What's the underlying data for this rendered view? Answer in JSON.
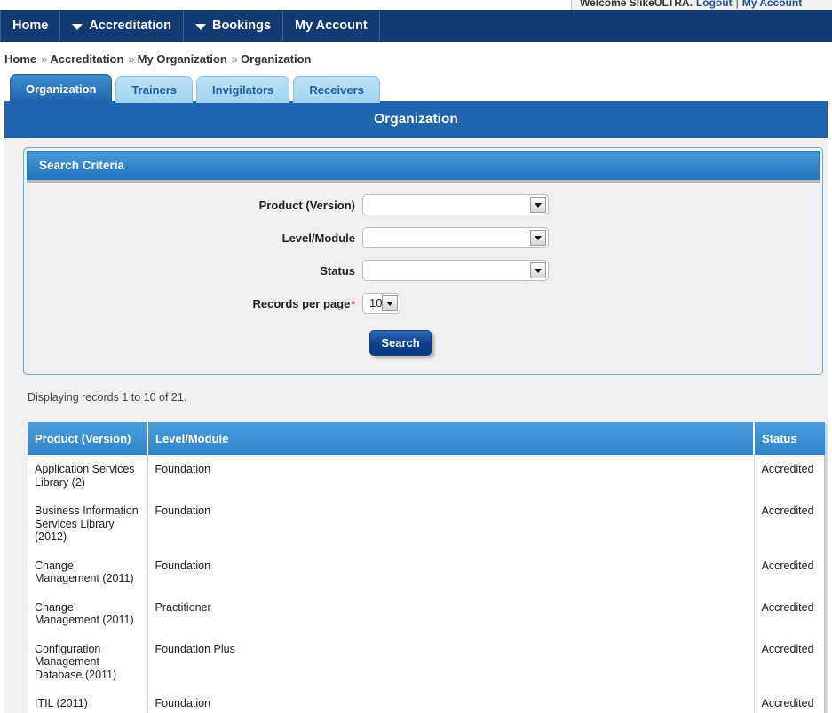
{
  "welcome": {
    "greeting": "Welcome SlikeULTRA.",
    "logout_label": "Logout",
    "separator": "|",
    "my_account_label": "My Account"
  },
  "navbar": {
    "items": [
      {
        "label": "Home",
        "has_caret": false
      },
      {
        "label": "Accreditation",
        "has_caret": true
      },
      {
        "label": "Bookings",
        "has_caret": true
      },
      {
        "label": "My Account",
        "has_caret": false
      }
    ]
  },
  "breadcrumb": {
    "separator": "»",
    "items": [
      "Home",
      "Accreditation",
      "My Organization",
      "Organization"
    ]
  },
  "tabs": [
    {
      "label": "Organization",
      "active": true
    },
    {
      "label": "Trainers",
      "active": false
    },
    {
      "label": "Invigilators",
      "active": false
    },
    {
      "label": "Receivers",
      "active": false
    }
  ],
  "page": {
    "title": "Organization"
  },
  "search_panel": {
    "header": "Search Criteria",
    "fields": [
      {
        "label": "Product (Version)",
        "value": "",
        "required": false
      },
      {
        "label": "Level/Module",
        "value": "",
        "required": false
      },
      {
        "label": "Status",
        "value": "",
        "required": false
      }
    ],
    "records_per_page": {
      "label": "Records per page",
      "required_marker": "*",
      "value": "10"
    },
    "search_button": "Search"
  },
  "results": {
    "displaying_text": "Displaying records 1 to 10 of 21.",
    "columns": [
      "Product (Version)",
      "Level/Module",
      "Status"
    ],
    "rows": [
      {
        "product": "Application Services Library (2)",
        "level": "Foundation",
        "status": "Accredited"
      },
      {
        "product": "Business Information Services Library (2012)",
        "level": "Foundation",
        "status": "Accredited"
      },
      {
        "product": "Change Management (2011)",
        "level": "Foundation",
        "status": "Accredited"
      },
      {
        "product": "Change Management (2011)",
        "level": "Practitioner",
        "status": "Accredited"
      },
      {
        "product": "Configuration Management Database (2011)",
        "level": "Foundation Plus",
        "status": "Accredited"
      },
      {
        "product": "ITIL (2011)",
        "level": "Foundation",
        "status": "Accredited"
      }
    ]
  },
  "colors": {
    "navbar_bg": "#123a73",
    "title_bar_bg": "#2065b0",
    "panel_header_blue": "#2272bd",
    "table_header_blue": "#3284c9",
    "tab_active_blue": "#1f62ab",
    "tab_inactive_blue": "#9ed4f2",
    "accent_link": "#1b4f9c",
    "required_star": "#d04a4a"
  }
}
